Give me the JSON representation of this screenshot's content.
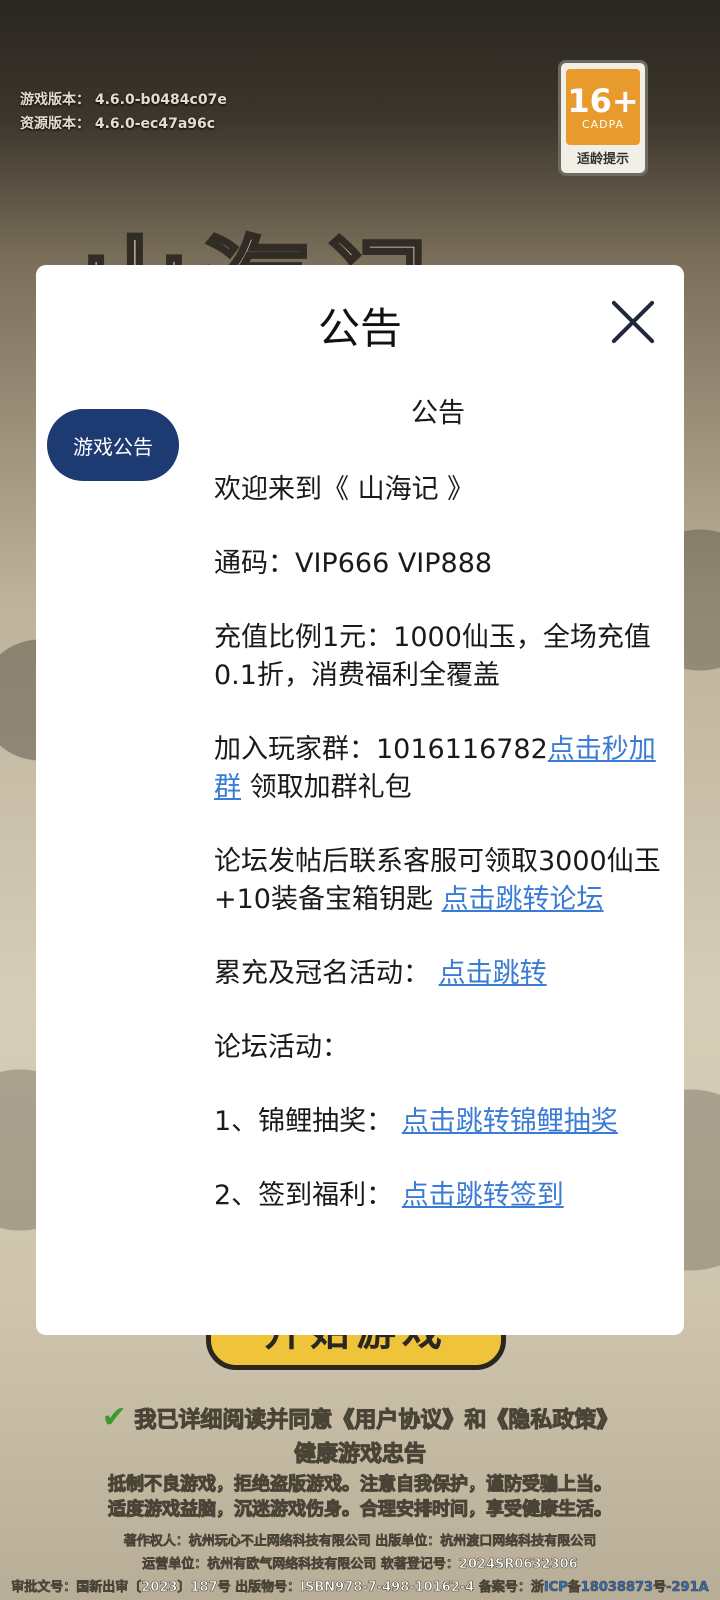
{
  "version": {
    "game_label": "游戏版本：",
    "game_value": "4.6.0-b0484c07e",
    "res_label": "资源版本：",
    "res_value": "4.6.0-ec47a96c"
  },
  "age_badge": {
    "number": "16+",
    "org": "CADPA",
    "tip": "适龄提示"
  },
  "background": {
    "logo": "山海记",
    "start_button": "开始游戏"
  },
  "modal": {
    "title": "公告",
    "tab_label": "游戏公告",
    "content_title": "公告",
    "welcome": "欢迎来到《 山海记 》",
    "codes": "通码：VIP666 VIP888",
    "recharge": "充值比例1元：1000仙玉，全场充值0.1折，消费福利全覆盖",
    "group_text": "加入玩家群：1016116782",
    "group_link": "点击秒加群",
    "group_suffix": " 领取加群礼包",
    "forum_text": "论坛发帖后联系客服可领取3000仙玉+10装备宝箱钥匙 ",
    "forum_link": "点击跳转论坛",
    "accum_text": "累充及冠名活动：",
    "accum_link": "点击跳转",
    "forum_activity": "论坛活动：",
    "koi_text": "1、锦鲤抽奖：",
    "koi_link": "点击跳转锦鲤抽奖",
    "signin_text": "2、签到福利：",
    "signin_link": "点击跳转签到"
  },
  "footer": {
    "agree_text": "我已详细阅读并同意",
    "user_agreement": "《用户协议》",
    "and": "和",
    "privacy_policy": "《隐私政策》",
    "health_title": "健康游戏忠告",
    "health_line1": "抵制不良游戏，拒绝盗版游戏。注意自我保护，谨防受骗上当。",
    "health_line2": "适度游戏益脑，沉迷游戏伤身。合理安排时间，享受健康生活。",
    "legal_line1": "著作权人：杭州玩心不止网络科技有限公司  出版单位：杭州渡口网络科技有限公司",
    "legal_line2": "运营单位：杭州有欧气网络科技有限公司  软著登记号：2024SR0632306",
    "legal_line3": "审批文号：国新出审〔2023〕187号 出版物号：ISBN978-7-498-10162-4 备案号：",
    "icp": "浙ICP备18038873号-291A"
  }
}
